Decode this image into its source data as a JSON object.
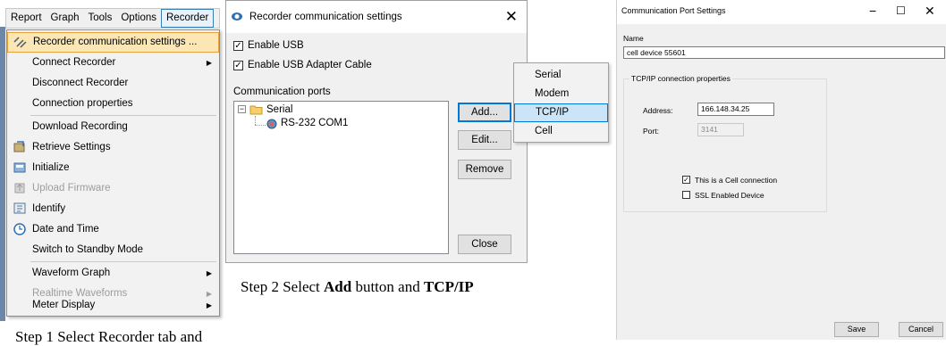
{
  "menu": {
    "bar": [
      {
        "label": "Report"
      },
      {
        "label": "Graph"
      },
      {
        "label": "Tools"
      },
      {
        "label": "Options"
      },
      {
        "label": "Recorder"
      }
    ],
    "items": [
      {
        "label": "Recorder communication settings ...",
        "icon": "recorder-settings-icon",
        "selected": true
      },
      {
        "label": "Connect Recorder",
        "submenu": true
      },
      {
        "label": "Disconnect Recorder"
      },
      {
        "label": "Connection properties"
      },
      {
        "label": "Download Recording"
      },
      {
        "label": "Retrieve Settings",
        "icon": "retrieve-icon"
      },
      {
        "label": "Initialize",
        "icon": "initialize-icon"
      },
      {
        "label": "Upload Firmware",
        "icon": "upload-icon",
        "disabled": true
      },
      {
        "label": "Identify",
        "icon": "identify-icon"
      },
      {
        "label": "Date and Time",
        "icon": "clock-icon"
      },
      {
        "label": "Switch to Standby Mode"
      },
      {
        "label": "Waveform Graph",
        "submenu": true
      },
      {
        "label": "Realtime Waveforms",
        "submenu": true,
        "disabled": true
      },
      {
        "label": "Meter Display",
        "submenu": true
      }
    ],
    "caption": "Step 1 Select Recorder tab and"
  },
  "comm_dialog": {
    "title": "Recorder communication settings",
    "enable_usb": "Enable USB",
    "enable_usb_adapter": "Enable USB Adapter Cable",
    "ports_label": "Communication ports",
    "tree_root": "Serial",
    "tree_child": "RS-232 COM1",
    "buttons": {
      "add": "Add...",
      "edit": "Edit...",
      "remove": "Remove",
      "close": "Close"
    },
    "add_menu": [
      "Serial",
      "Modem",
      "TCP/IP",
      "Cell"
    ],
    "add_menu_highlight": "TCP/IP",
    "caption_prefix": "Step 2 Select ",
    "caption_add": "Add",
    "caption_mid": " button and ",
    "caption_tcp": "TCP/IP"
  },
  "port_dialog": {
    "title": "Communication Port Settings",
    "name_label": "Name",
    "name_value": "cell device 55601",
    "group_label": "TCP/IP connection properties",
    "address_label": "Address:",
    "address_value": "166.148.34.25",
    "port_label": "Port:",
    "port_value": "3141",
    "cell_checkbox": "This is a Cell connection",
    "ssl_checkbox": "SSL Enabled Device",
    "save": "Save",
    "cancel": "Cancel"
  },
  "colors": {
    "menu_highlight": "#fbe7b5",
    "popup_highlight": "#cce4f7",
    "accent": "#0078d7"
  }
}
